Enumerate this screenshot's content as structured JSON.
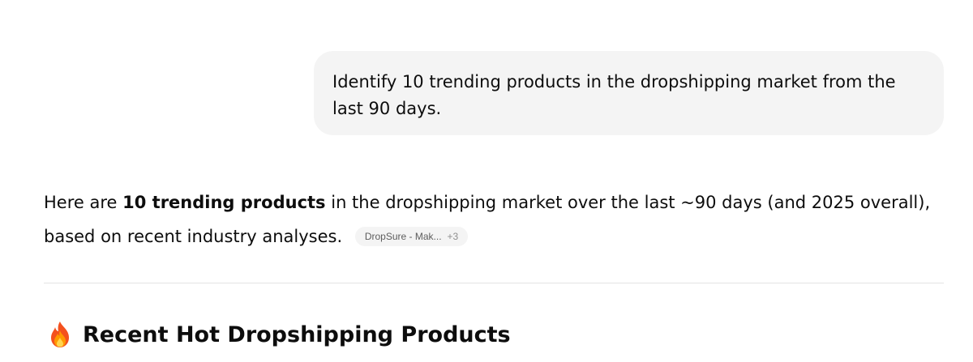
{
  "user_message": {
    "text": "Identify 10 trending products in the dropshipping market from the last 90 days."
  },
  "assistant_message": {
    "intro_before": "Here are ",
    "intro_bold": "10 trending products",
    "intro_after": " in the dropshipping market over the last ~90 days (and 2025 overall), based on recent industry analyses.",
    "citation": {
      "source_label": "DropSure - Mak...",
      "more_count": "+3"
    }
  },
  "section": {
    "icon": "fire-icon",
    "title": "Recent Hot Dropshipping Products"
  }
}
